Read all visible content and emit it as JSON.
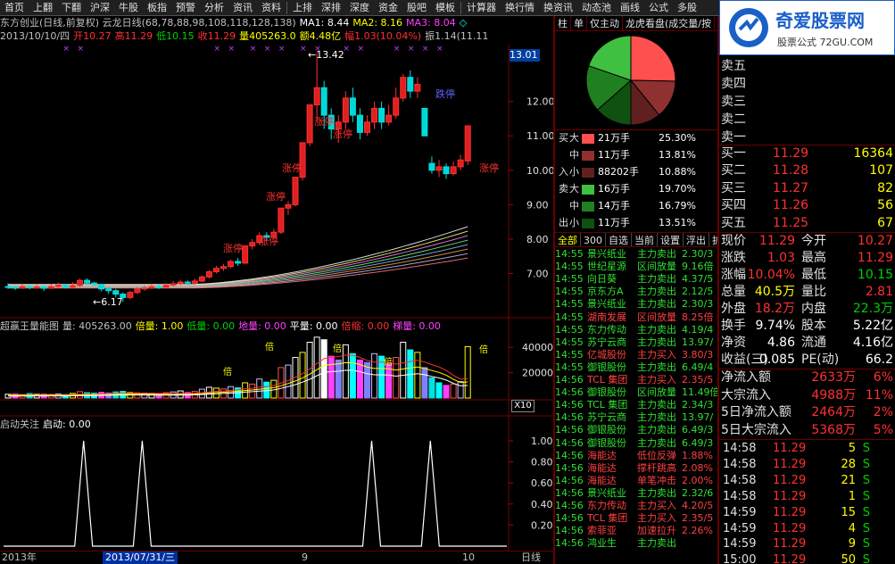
{
  "toolbar": {
    "items": [
      "首页",
      "上翻",
      "下翻",
      "沪深",
      "牛股",
      "板指",
      "预警",
      "分析",
      "资讯",
      "资料",
      "上排",
      "深排",
      "深度",
      "资金",
      "股吧",
      "模板",
      "计算器",
      "换行情",
      "换资讯",
      "动态池",
      "画线",
      "公式",
      "多股"
    ]
  },
  "header": {
    "title": "东方创业(日线,前复权) 云龙日线(68,78,88,98,108,118,128,138)",
    "ma1": "MA1: 8.44",
    "ma2": "MA2: 8.16",
    "ma3": "MA3: 8.04",
    "date": "2013/10/10/四",
    "open": "开10.27",
    "high": "高11.29",
    "low": "低10.15",
    "close": "收11.29",
    "volume": "量405263.0",
    "amount": "额4.48亿",
    "change": "幅1.03(10.04%)",
    "amplitude": "振1.14(11.11"
  },
  "kline": {
    "price_ticks": [
      "13.01",
      "12.00",
      "11.00",
      "10.00",
      "9.00",
      "8.00",
      "7.00"
    ],
    "high_label": "13.42",
    "low_label": "6.17",
    "limit_label": "涨停",
    "down_label": "跌停"
  },
  "volume_panel": {
    "title": "超赢王量能图",
    "vol": "量: 405263.00",
    "bei": "倍量: 1.00",
    "di": "低量: 0.00",
    "de": "地量: 0.00",
    "ping": "平量: 0.00",
    "beisuo": "倍缩: 0.00",
    "ti": "梯量: 0.00",
    "ticks": [
      "40000",
      "20000"
    ],
    "unit": "X10",
    "bei_mark": "倍"
  },
  "signal_panel": {
    "title": "启动关注",
    "value": "启动: 0.00",
    "ticks": [
      "1.00",
      "0.80",
      "0.60",
      "0.40",
      "0.20"
    ]
  },
  "bottom_bar": {
    "year": "2013年",
    "date": "2013/07/31/三",
    "m9": "9",
    "m10": "10",
    "period": "日线"
  },
  "longhu": {
    "tabs": [
      "柱",
      "单",
      "仅主动",
      "龙虎看盘(成交量/按"
    ],
    "buy_side": "买",
    "sell_side": "卖",
    "in_label": "入",
    "out_label": "出",
    "buy": [
      {
        "size": "大",
        "amount": "21万手",
        "pct": "25.30%",
        "color": "#ff5050"
      },
      {
        "size": "中",
        "amount": "11万手",
        "pct": "13.81%",
        "color": "#903030"
      },
      {
        "size": "小",
        "amount": "88202手",
        "pct": "10.88%",
        "color": "#602020"
      }
    ],
    "sell": [
      {
        "size": "大",
        "amount": "16万手",
        "pct": "19.70%",
        "color": "#40c040"
      },
      {
        "size": "中",
        "amount": "14万手",
        "pct": "16.79%",
        "color": "#208020"
      },
      {
        "size": "小",
        "amount": "11万手",
        "pct": "13.51%",
        "color": "#105010"
      }
    ],
    "pie": [
      25.3,
      13.81,
      10.88,
      13.51,
      16.79,
      19.7
    ]
  },
  "list_tabs": [
    "全部",
    "300",
    "自选",
    "当前",
    "设置",
    "浮出",
    "扩"
  ],
  "list_rows": [
    {
      "time": "14:55",
      "name": "景兴纸业",
      "type": "主力卖出",
      "val": "2.30/3",
      "dir": "sell"
    },
    {
      "time": "14:55",
      "name": "世纪星源",
      "type": "区间放量",
      "val": "9.16倍",
      "dir": "sell"
    },
    {
      "time": "14:55",
      "name": "向日葵",
      "type": "主力卖出",
      "val": "4.37/5",
      "dir": "sell"
    },
    {
      "time": "14:55",
      "name": "京东方A",
      "type": "主力卖出",
      "val": "2.12/5",
      "dir": "sell"
    },
    {
      "time": "14:55",
      "name": "景兴纸业",
      "type": "主力卖出",
      "val": "2.30/3",
      "dir": "sell"
    },
    {
      "time": "14:55",
      "name": "湖南发展",
      "type": "区间放量",
      "val": "8.25倍",
      "dir": "buy"
    },
    {
      "time": "14:55",
      "name": "东力传动",
      "type": "主力卖出",
      "val": "4.19/4",
      "dir": "sell"
    },
    {
      "time": "14:55",
      "name": "苏宁云商",
      "type": "主力卖出",
      "val": "13.97/",
      "dir": "sell"
    },
    {
      "time": "14:55",
      "name": "亿城股份",
      "type": "主力买入",
      "val": "3.80/3",
      "dir": "buy"
    },
    {
      "time": "14:55",
      "name": "御银股份",
      "type": "主力卖出",
      "val": "6.49/4",
      "dir": "sell"
    },
    {
      "time": "14:56",
      "name": "TCL 集团",
      "type": "主力买入",
      "val": "2.35/5",
      "dir": "buy"
    },
    {
      "time": "14:56",
      "name": "御银股份",
      "type": "区间放量",
      "val": "11.49倍",
      "dir": "sell"
    },
    {
      "time": "14:56",
      "name": "TCL 集团",
      "type": "主力卖出",
      "val": "2.34/3",
      "dir": "sell"
    },
    {
      "time": "14:56",
      "name": "苏宁云商",
      "type": "主力卖出",
      "val": "13.97/",
      "dir": "sell"
    },
    {
      "time": "14:56",
      "name": "御银股份",
      "type": "主力卖出",
      "val": "6.49/3",
      "dir": "sell"
    },
    {
      "time": "14:56",
      "name": "御银股份",
      "type": "主力卖出",
      "val": "6.49/3",
      "dir": "sell"
    },
    {
      "time": "14:56",
      "name": "海能达",
      "type": "低位反弹",
      "val": "1.88%",
      "dir": "buy"
    },
    {
      "time": "14:56",
      "name": "海能达",
      "type": "撑杆跳高",
      "val": "2.08%",
      "dir": "buy"
    },
    {
      "time": "14:56",
      "name": "海能达",
      "type": "单笔冲击",
      "val": "2.00%",
      "dir": "buy"
    },
    {
      "time": "14:56",
      "name": "景兴纸业",
      "type": "主力卖出",
      "val": "2.32/6",
      "dir": "sell"
    },
    {
      "time": "14:56",
      "name": "东力传动",
      "type": "主力买入",
      "val": "4.20/5",
      "dir": "buy"
    },
    {
      "time": "14:56",
      "name": "TCL 集团",
      "type": "主力买入",
      "val": "2.35/5",
      "dir": "buy"
    },
    {
      "time": "14:56",
      "name": "索菲亚",
      "type": "加速拉升",
      "val": "2.26%",
      "dir": "buy"
    },
    {
      "time": "14:56",
      "name": "鸿业生",
      "type": "主力卖出",
      "val": "",
      "dir": "sell"
    }
  ],
  "logo": {
    "name": "奇爱股票网",
    "sub": "股票公式 72GU.COM"
  },
  "sell_levels": [
    "卖五",
    "卖四",
    "卖三",
    "卖二",
    "卖一"
  ],
  "buy_levels": [
    {
      "label": "买一",
      "price": "11.29",
      "vol": "16364"
    },
    {
      "label": "买二",
      "price": "11.28",
      "vol": "107"
    },
    {
      "label": "买三",
      "price": "11.27",
      "vol": "82"
    },
    {
      "label": "买四",
      "price": "11.26",
      "vol": "56"
    },
    {
      "label": "买五",
      "price": "11.25",
      "vol": "67"
    }
  ],
  "stats": [
    {
      "l1": "现价",
      "v1": "11.29",
      "l2": "今开",
      "v2": "10.27",
      "c1": "red",
      "c2": "red"
    },
    {
      "l1": "涨跌",
      "v1": "1.03",
      "l2": "最高",
      "v2": "11.29",
      "c1": "red",
      "c2": "red"
    },
    {
      "l1": "涨幅",
      "v1": "10.04%",
      "l2": "最低",
      "v2": "10.15",
      "c1": "red",
      "c2": "green"
    },
    {
      "l1": "总量",
      "v1": "40.5万",
      "l2": "量比",
      "v2": "2.81",
      "c1": "yellow",
      "c2": "red"
    },
    {
      "l1": "外盘",
      "v1": "18.2万",
      "l2": "内盘",
      "v2": "22.3万",
      "c1": "red",
      "c2": "green"
    },
    {
      "l1": "换手",
      "v1": "9.74%",
      "l2": "股本",
      "v2": "5.22亿",
      "c1": "white",
      "c2": "white"
    },
    {
      "l1": "净资",
      "v1": "4.86",
      "l2": "流通",
      "v2": "4.16亿",
      "c1": "white",
      "c2": "white"
    },
    {
      "l1": "收益(三)",
      "v1": "0.085",
      "l2": "PE(动)",
      "v2": "66.2",
      "c1": "white",
      "c2": "white"
    }
  ],
  "flows": [
    {
      "label": "净流入额",
      "val": "2633万",
      "pct": "6%"
    },
    {
      "label": "大宗流入",
      "val": "4988万",
      "pct": "11%"
    },
    {
      "label": "5日净流入额",
      "val": "2464万",
      "pct": "2%"
    },
    {
      "label": "5日大宗流入",
      "val": "5368万",
      "pct": "5%"
    }
  ],
  "ticks": [
    {
      "time": "14:58",
      "price": "11.29",
      "vol": "5",
      "side": "S"
    },
    {
      "time": "14:58",
      "price": "11.29",
      "vol": "28",
      "side": "S"
    },
    {
      "time": "14:58",
      "price": "11.29",
      "vol": "21",
      "side": "S"
    },
    {
      "time": "14:58",
      "price": "11.29",
      "vol": "1",
      "side": "S"
    },
    {
      "time": "14:59",
      "price": "11.29",
      "vol": "15",
      "side": "S"
    },
    {
      "time": "14:59",
      "price": "11.29",
      "vol": "4",
      "side": "S"
    },
    {
      "time": "14:59",
      "price": "11.29",
      "vol": "9",
      "side": "S"
    },
    {
      "time": "15:00",
      "price": "11.29",
      "vol": "50",
      "side": "S"
    }
  ],
  "candles": [
    [
      6.62,
      6.6,
      6.72,
      6.55
    ],
    [
      6.6,
      6.58,
      6.65,
      6.52
    ],
    [
      6.58,
      6.62,
      6.7,
      6.55
    ],
    [
      6.62,
      6.6,
      6.66,
      6.54
    ],
    [
      6.6,
      6.61,
      6.68,
      6.56
    ],
    [
      6.61,
      6.57,
      6.64,
      6.5
    ],
    [
      6.57,
      6.62,
      6.7,
      6.55
    ],
    [
      6.62,
      6.66,
      6.74,
      6.58
    ],
    [
      6.66,
      6.6,
      6.7,
      6.56
    ],
    [
      6.6,
      6.65,
      6.75,
      6.58
    ],
    [
      6.65,
      6.8,
      6.85,
      6.6
    ],
    [
      6.8,
      6.72,
      6.86,
      6.68
    ],
    [
      6.72,
      6.68,
      6.76,
      6.62
    ],
    [
      6.68,
      6.55,
      6.7,
      6.48
    ],
    [
      6.55,
      6.5,
      6.6,
      6.4
    ],
    [
      6.5,
      6.4,
      6.55,
      6.3
    ],
    [
      6.4,
      6.3,
      6.45,
      6.17
    ],
    [
      6.3,
      6.45,
      6.5,
      6.25
    ],
    [
      6.45,
      6.55,
      6.6,
      6.4
    ],
    [
      6.55,
      6.58,
      6.65,
      6.5
    ],
    [
      6.58,
      6.62,
      6.7,
      6.55
    ],
    [
      6.62,
      6.6,
      6.68,
      6.55
    ],
    [
      6.6,
      6.66,
      6.72,
      6.58
    ],
    [
      6.66,
      6.7,
      6.78,
      6.62
    ],
    [
      6.7,
      6.75,
      6.82,
      6.66
    ],
    [
      6.75,
      6.72,
      6.8,
      6.66
    ],
    [
      6.72,
      6.78,
      6.85,
      6.68
    ],
    [
      6.78,
      6.9,
      6.95,
      6.75
    ],
    [
      6.9,
      7.05,
      7.1,
      6.85
    ],
    [
      7.05,
      7.15,
      7.22,
      7.0
    ],
    [
      7.15,
      7.2,
      7.28,
      7.08
    ],
    [
      7.2,
      7.35,
      7.4,
      7.15
    ],
    [
      7.35,
      7.3,
      7.45,
      7.22
    ],
    [
      7.3,
      7.8,
      7.8,
      7.28
    ],
    [
      7.8,
      7.9,
      8.0,
      7.7
    ],
    [
      7.9,
      8.1,
      8.2,
      7.85
    ],
    [
      8.1,
      8.05,
      8.2,
      7.95
    ],
    [
      8.05,
      8.2,
      8.3,
      8.0
    ],
    [
      8.2,
      8.9,
      8.9,
      8.15
    ],
    [
      8.9,
      9.0,
      9.1,
      8.7
    ],
    [
      9.0,
      9.8,
      9.8,
      8.95
    ],
    [
      9.8,
      10.8,
      10.8,
      9.7
    ],
    [
      10.8,
      11.9,
      11.9,
      10.7
    ],
    [
      11.9,
      12.4,
      13.42,
      11.4
    ],
    [
      12.4,
      11.6,
      12.6,
      11.2
    ],
    [
      11.6,
      11.2,
      11.8,
      10.9
    ],
    [
      11.2,
      11.4,
      11.6,
      10.8
    ],
    [
      11.4,
      12.1,
      12.3,
      11.2
    ],
    [
      12.1,
      11.6,
      12.4,
      11.4
    ],
    [
      11.6,
      11.1,
      11.8,
      10.9
    ],
    [
      11.1,
      11.4,
      11.6,
      11.0
    ],
    [
      11.4,
      11.8,
      12.0,
      11.2
    ],
    [
      11.8,
      11.4,
      12.0,
      11.2
    ],
    [
      11.4,
      11.6,
      11.9,
      11.3
    ],
    [
      11.6,
      12.1,
      12.4,
      11.5
    ],
    [
      12.1,
      12.7,
      12.8,
      12.0
    ],
    [
      12.7,
      12.3,
      12.9,
      12.1
    ],
    [
      12.3,
      12.5,
      12.7,
      12.1
    ],
    [
      11.8,
      11.0,
      11.8,
      11.0
    ],
    [
      10.2,
      10.0,
      10.4,
      9.9
    ],
    [
      10.0,
      10.1,
      10.3,
      9.8
    ],
    [
      10.1,
      9.9,
      10.2,
      9.75
    ],
    [
      9.9,
      10.1,
      10.25,
      9.85
    ],
    [
      10.1,
      10.3,
      10.45,
      10.0
    ],
    [
      10.27,
      11.29,
      11.29,
      10.15
    ]
  ],
  "volumes": [
    [
      3000,
      0
    ],
    [
      3200,
      1
    ],
    [
      2800,
      0
    ],
    [
      3500,
      1
    ],
    [
      3000,
      0
    ],
    [
      3100,
      1
    ],
    [
      2900,
      0
    ],
    [
      3300,
      0
    ],
    [
      2700,
      1
    ],
    [
      3600,
      0
    ],
    [
      5000,
      0
    ],
    [
      4200,
      1
    ],
    [
      3800,
      1
    ],
    [
      4500,
      1
    ],
    [
      4000,
      1
    ],
    [
      4800,
      1
    ],
    [
      5200,
      1
    ],
    [
      4300,
      0
    ],
    [
      4100,
      0
    ],
    [
      3900,
      0
    ],
    [
      3700,
      0
    ],
    [
      3500,
      1
    ],
    [
      4200,
      0
    ],
    [
      4800,
      0
    ],
    [
      5600,
      0
    ],
    [
      4400,
      1
    ],
    [
      5200,
      0
    ],
    [
      7000,
      0
    ],
    [
      8500,
      0
    ],
    [
      7800,
      0
    ],
    [
      7200,
      0
    ],
    [
      9000,
      0
    ],
    [
      8000,
      1
    ],
    [
      12000,
      0
    ],
    [
      11000,
      0
    ],
    [
      15000,
      0
    ],
    [
      12500,
      1
    ],
    [
      14000,
      0
    ],
    [
      24000,
      0
    ],
    [
      26000,
      0
    ],
    [
      32000,
      0
    ],
    [
      36000,
      0
    ],
    [
      44000,
      0
    ],
    [
      48000,
      0
    ],
    [
      46000,
      1
    ],
    [
      33000,
      1
    ],
    [
      30000,
      1
    ],
    [
      42000,
      0
    ],
    [
      35000,
      1
    ],
    [
      30000,
      1
    ],
    [
      28000,
      1
    ],
    [
      35000,
      0
    ],
    [
      33000,
      1
    ],
    [
      27000,
      1
    ],
    [
      32000,
      0
    ],
    [
      44000,
      0
    ],
    [
      38000,
      1
    ],
    [
      36000,
      0
    ],
    [
      24000,
      1
    ],
    [
      16000,
      1
    ],
    [
      12000,
      1
    ],
    [
      10000,
      1
    ],
    [
      11000,
      0
    ],
    [
      13000,
      0
    ],
    [
      40526,
      0
    ]
  ],
  "signal_peaks": [
    0.15,
    0.26,
    0.69,
    0.8
  ]
}
